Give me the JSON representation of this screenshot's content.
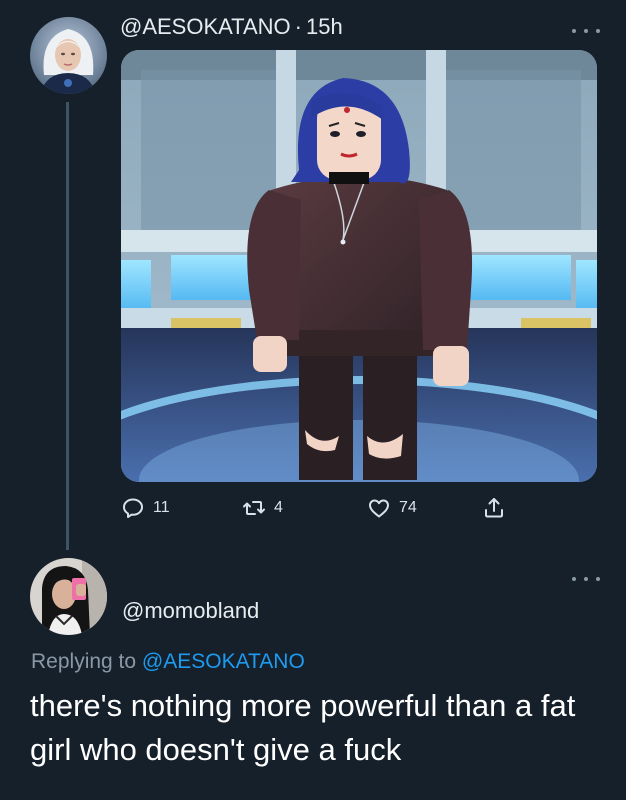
{
  "tweet": {
    "handle": "@AESOKATANO",
    "separator": "·",
    "time": "15h",
    "image_subject": "Roblox avatar with blue hair in a dark red sweater standing in a futuristic room",
    "stats": {
      "replies": "11",
      "retweets": "4",
      "likes": "74"
    },
    "icons": {
      "reply": "reply-icon",
      "retweet": "retweet-icon",
      "like": "heart-icon",
      "share": "share-icon",
      "more": "more-icon"
    }
  },
  "reply": {
    "handle": "@momobland",
    "replying_prefix": "Replying to",
    "replying_to": "@AESOKATANO",
    "text": "there's nothing more powerful than a fat girl who doesn't give a fuck"
  },
  "colors": {
    "background": "#15202b",
    "accent": "#1d9bf0",
    "muted": "#8b98a5",
    "thread_line": "#3d5466"
  }
}
